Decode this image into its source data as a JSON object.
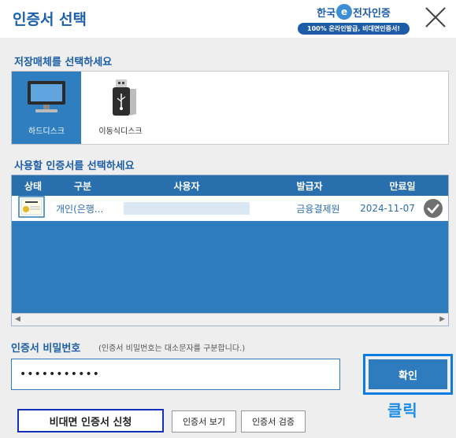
{
  "header": {
    "title": "인증서 선택",
    "logo_text_left": "한국",
    "logo_mark": "e",
    "logo_text_right": "전자인증",
    "logo_badge": "100% 온라인발급, 비대면인증서!"
  },
  "storage": {
    "label": "저장매체를 선택하세요",
    "media": [
      {
        "label": "하드디스크",
        "icon": "monitor-icon",
        "selected": true
      },
      {
        "label": "이동식디스크",
        "icon": "usb-drive-icon",
        "selected": false
      }
    ]
  },
  "certificates": {
    "label": "사용할 인증서를 선택하세요",
    "columns": [
      "상태",
      "구분",
      "사용자",
      "발급자",
      "만료일"
    ],
    "rows": [
      {
        "status_icon": "certificate-icon",
        "type": "개인(은행...",
        "user": "",
        "issuer": "금융결제원",
        "expiry": "2024-11-07",
        "check_icon": "check-circle-icon"
      }
    ]
  },
  "password": {
    "label": "인증서 비밀번호",
    "hint": "(인증서 비밀번호는 대소문자를 구분합니다.)",
    "value": "•••••••••••"
  },
  "buttons": {
    "confirm": "확인",
    "click_hint": "클릭",
    "contactless": "비대면 인증서 신청",
    "view_cert": "인증서 보기",
    "verify_cert": "인증서 검증"
  },
  "colors": {
    "accent": "#2e7bbd",
    "title": "#1c5fa8",
    "highlight": "#0a7be0"
  }
}
